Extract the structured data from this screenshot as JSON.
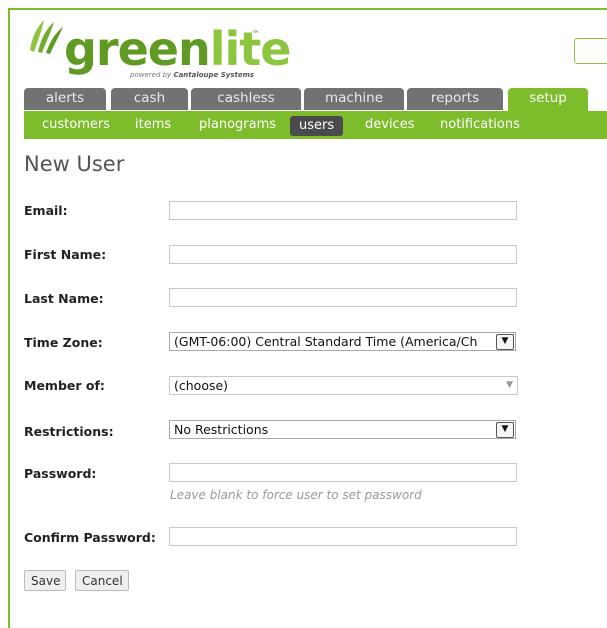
{
  "logo": {
    "word_part1": "green",
    "word_part2": "lite",
    "tm": "™",
    "powered_by": "powered by",
    "company": "Cantaloupe Systems",
    "colors": {
      "dark": "#5f9a22",
      "light": "#8cc63f"
    }
  },
  "tabs": [
    {
      "label": "alerts"
    },
    {
      "label": "cash"
    },
    {
      "label": "cashless"
    },
    {
      "label": "machine"
    },
    {
      "label": "reports"
    },
    {
      "label": "setup",
      "active": true
    }
  ],
  "subnav": [
    {
      "label": "customers"
    },
    {
      "label": "items"
    },
    {
      "label": "planograms"
    },
    {
      "label": "users",
      "active": true
    },
    {
      "label": "devices"
    },
    {
      "label": "notifications"
    }
  ],
  "page": {
    "title": "New User"
  },
  "form": {
    "email_label": "Email:",
    "email_value": "",
    "first_name_label": "First Name:",
    "first_name_value": "",
    "last_name_label": "Last Name:",
    "last_name_value": "",
    "time_zone_label": "Time Zone:",
    "time_zone_value": "(GMT-06:00) Central Standard Time (America/Ch",
    "member_of_label": "Member of:",
    "member_of_value": "(choose)",
    "restrictions_label": "Restrictions:",
    "restrictions_value": "No Restrictions",
    "password_label": "Password:",
    "password_value": "",
    "password_hint": "Leave blank to force user to set password",
    "confirm_password_label": "Confirm Password:",
    "confirm_password_value": ""
  },
  "buttons": {
    "save": "Save",
    "cancel": "Cancel"
  },
  "colors": {
    "accent": "#7dbd2c",
    "tab_inactive": "#727272",
    "subnav_active": "#4b4b4b"
  },
  "icons": {
    "dropdown": "chevron-down-icon"
  }
}
